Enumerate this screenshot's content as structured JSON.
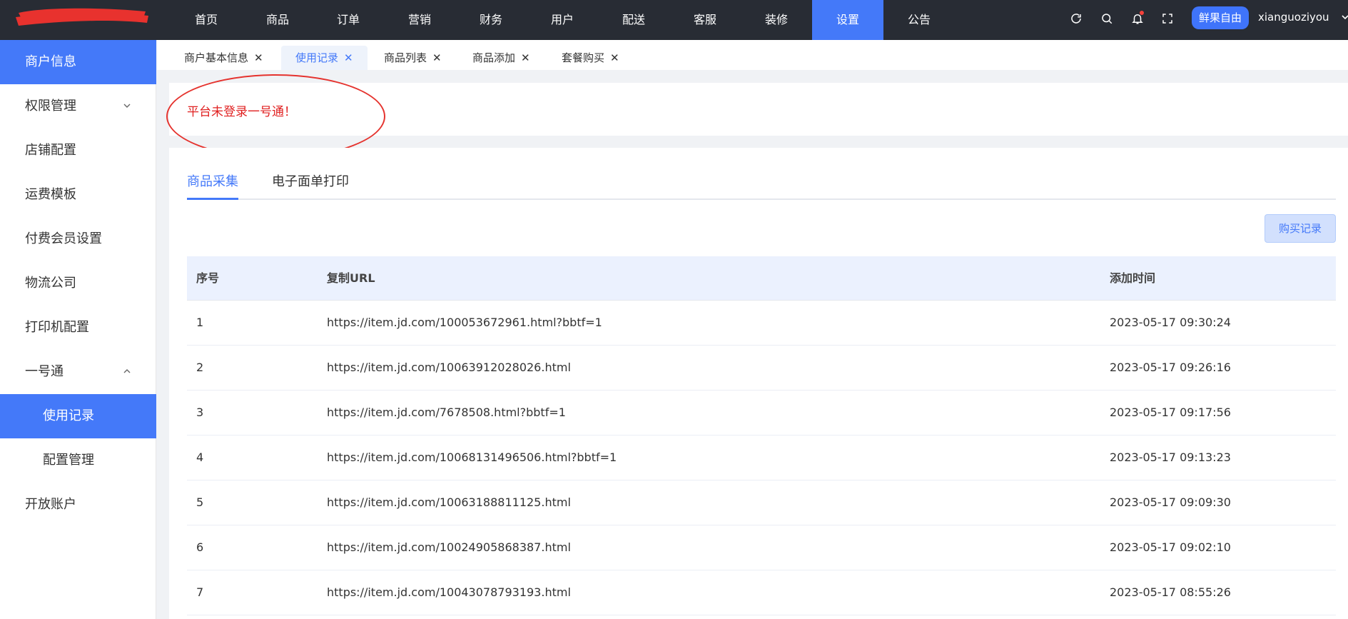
{
  "topnav": {
    "items": [
      "首页",
      "商品",
      "订单",
      "营销",
      "财务",
      "用户",
      "配送",
      "客服",
      "装修",
      "设置",
      "公告"
    ],
    "active_index": 9,
    "brand_button": "鲜果自由",
    "username": "xianguoziyou"
  },
  "sidebar": {
    "items": [
      {
        "label": "商户信息"
      },
      {
        "label": "权限管理"
      },
      {
        "label": "店铺配置"
      },
      {
        "label": "运费模板"
      },
      {
        "label": "付费会员设置"
      },
      {
        "label": "物流公司"
      },
      {
        "label": "打印机配置"
      },
      {
        "label": "一号通"
      },
      {
        "label": "使用记录"
      },
      {
        "label": "配置管理"
      },
      {
        "label": "开放账户"
      }
    ]
  },
  "page_tabs": [
    "商户基本信息",
    "使用记录",
    "商品列表",
    "商品添加",
    "套餐购买"
  ],
  "alert": {
    "text": "平台未登录一号通！"
  },
  "subtabs": [
    "商品采集",
    "电子面单打印"
  ],
  "buy_record_button": "购买记录",
  "table": {
    "headers": [
      "序号",
      "复制URL",
      "添加时间"
    ],
    "rows": [
      [
        "1",
        "https://item.jd.com/100053672961.html?bbtf=1",
        "2023-05-17 09:30:24"
      ],
      [
        "2",
        "https://item.jd.com/10063912028026.html",
        "2023-05-17 09:26:16"
      ],
      [
        "3",
        "https://item.jd.com/7678508.html?bbtf=1",
        "2023-05-17 09:17:56"
      ],
      [
        "4",
        "https://item.jd.com/10068131496506.html?bbtf=1",
        "2023-05-17 09:13:23"
      ],
      [
        "5",
        "https://item.jd.com/10063188811125.html",
        "2023-05-17 09:09:30"
      ],
      [
        "6",
        "https://item.jd.com/10024905868387.html",
        "2023-05-17 09:02:10"
      ],
      [
        "7",
        "https://item.jd.com/10043078793193.html",
        "2023-05-17 08:55:26"
      ]
    ]
  },
  "colors": {
    "topbar_bg": "#282c34",
    "accent": "#4479f9",
    "alert_text": "#e02020",
    "annotation_ellipse": "#e5332e"
  }
}
